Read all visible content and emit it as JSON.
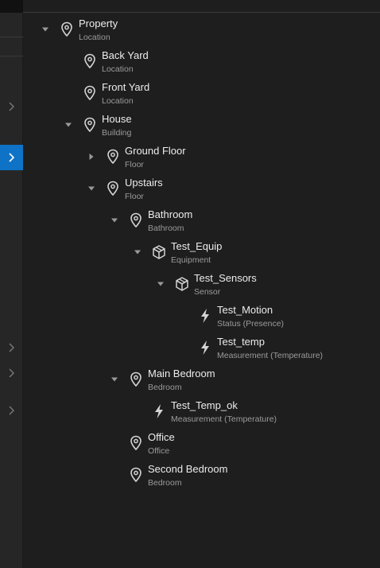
{
  "tree": [
    {
      "name": "Property",
      "type": "Location",
      "icon": "location-pin-icon",
      "expanded": true,
      "level": 0
    },
    {
      "name": "Back Yard",
      "type": "Location",
      "icon": "location-pin-icon",
      "level": 1
    },
    {
      "name": "Front Yard",
      "type": "Location",
      "icon": "location-pin-icon",
      "level": 1
    },
    {
      "name": "House",
      "type": "Building",
      "icon": "location-pin-icon",
      "expanded": true,
      "level": 1
    },
    {
      "name": "Ground Floor",
      "type": "Floor",
      "icon": "location-pin-icon",
      "expanded": false,
      "level": 2
    },
    {
      "name": "Upstairs",
      "type": "Floor",
      "icon": "location-pin-icon",
      "expanded": true,
      "level": 2
    },
    {
      "name": "Bathroom",
      "type": "Bathroom",
      "icon": "location-pin-icon",
      "expanded": true,
      "level": 3
    },
    {
      "name": "Test_Equip",
      "type": "Equipment",
      "icon": "box-icon",
      "expanded": true,
      "level": 4
    },
    {
      "name": "Test_Sensors",
      "type": "Sensor",
      "icon": "box-icon",
      "expanded": true,
      "level": 5
    },
    {
      "name": "Test_Motion",
      "type": "Status (Presence)",
      "icon": "lightning-icon",
      "level": 6
    },
    {
      "name": "Test_temp",
      "type": "Measurement (Temperature)",
      "icon": "lightning-icon",
      "level": 6
    },
    {
      "name": "Main Bedroom",
      "type": "Bedroom",
      "icon": "location-pin-icon",
      "expanded": true,
      "level": 3
    },
    {
      "name": "Test_Temp_ok",
      "type": "Measurement (Temperature)",
      "icon": "lightning-icon",
      "level": 4
    },
    {
      "name": "Office",
      "type": "Office",
      "icon": "location-pin-icon",
      "level": 3
    },
    {
      "name": "Second Bedroom",
      "type": "Bedroom",
      "icon": "location-pin-icon",
      "level": 3
    }
  ],
  "colors": {
    "background": "#1e1e1e",
    "rail": "#262626",
    "accent": "#0e72c6",
    "label": "#ececec",
    "sublabel": "#9b9b9b"
  }
}
